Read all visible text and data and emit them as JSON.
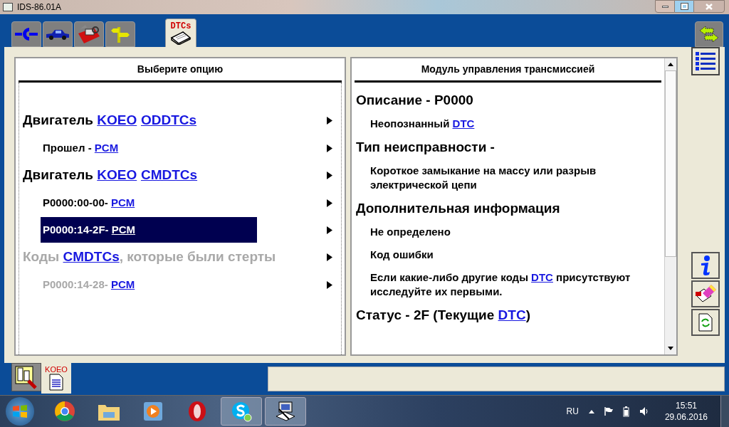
{
  "window": {
    "title": "IDS-86.01A"
  },
  "top_tabs": [
    {
      "kind": "connect",
      "selected": false
    },
    {
      "kind": "car",
      "selected": false
    },
    {
      "kind": "toolbox",
      "selected": false
    },
    {
      "kind": "signpost",
      "selected": false
    },
    {
      "kind": "dtc",
      "label": "DTCs",
      "selected": true
    }
  ],
  "left_panel": {
    "title": "Выберите опцию",
    "items": [
      {
        "kind": "heading",
        "selected": false,
        "disabled": false,
        "parts": [
          {
            "text": "Двигатель "
          },
          {
            "text": "KOEO",
            "link": true
          },
          {
            "text": "ODDTCs",
            "link": true
          }
        ]
      },
      {
        "kind": "sub",
        "selected": false,
        "disabled": false,
        "parts": [
          {
            "text": "Прошел - "
          },
          {
            "text": "PCM",
            "link": true
          }
        ]
      },
      {
        "kind": "heading",
        "selected": false,
        "disabled": false,
        "parts": [
          {
            "text": "Двигатель "
          },
          {
            "text": "KOEO",
            "link": true
          },
          {
            "text": "CMDTCs",
            "link": true
          }
        ]
      },
      {
        "kind": "sub",
        "selected": false,
        "disabled": false,
        "parts": [
          {
            "text": "P0000:00-00- "
          },
          {
            "text": "PCM",
            "link": true
          }
        ]
      },
      {
        "kind": "sub",
        "selected": true,
        "disabled": false,
        "parts": [
          {
            "text": "P0000:14-2F- "
          },
          {
            "text": "PCM",
            "link": true
          }
        ]
      },
      {
        "kind": "heading",
        "selected": false,
        "disabled": true,
        "parts": [
          {
            "text": "Коды "
          },
          {
            "text": "CMDTCs",
            "link": true
          },
          {
            "text": ", которые были стерты"
          }
        ]
      },
      {
        "kind": "sub",
        "selected": false,
        "disabled": true,
        "parts": [
          {
            "text": "P0000:14-28- "
          },
          {
            "text": "PCM",
            "link": true
          }
        ]
      }
    ]
  },
  "right_panel": {
    "title": "Модуль управления трансмиссией",
    "sections": [
      {
        "heading": [
          {
            "text": "Описание - P0000"
          }
        ],
        "paragraphs": [
          [
            {
              "text": "Неопознанный "
            },
            {
              "text": "DTC",
              "link": true
            }
          ]
        ]
      },
      {
        "heading": [
          {
            "text": "Тип неисправности -"
          }
        ],
        "paragraphs": [
          [
            {
              "text": "Короткое замыкание на массу или разрыв электрической цепи"
            }
          ]
        ]
      },
      {
        "heading": [
          {
            "text": "Дополнительная информация"
          }
        ],
        "paragraphs": [
          [
            {
              "text": "Не определено"
            }
          ],
          [
            {
              "text": "Код ошибки"
            }
          ],
          [
            {
              "text": "Если какие-либо другие коды "
            },
            {
              "text": "DTC",
              "link": true
            },
            {
              "text": " присутствуют исследуйте их первыми."
            }
          ]
        ]
      },
      {
        "heading": [
          {
            "text": "Статус - 2F (Текущие "
          },
          {
            "text": "DTC",
            "link": true
          },
          {
            "text": ")"
          }
        ]
      }
    ]
  },
  "side_buttons": [
    {
      "kind": "info"
    },
    {
      "kind": "erase"
    },
    {
      "kind": "refresh"
    }
  ],
  "bottom_tabs": [
    {
      "kind": "report",
      "selected": false
    },
    {
      "kind": "doc",
      "label": "KOEO",
      "selected": true
    }
  ],
  "taskbar": {
    "apps": [
      {
        "kind": "chrome",
        "active": false
      },
      {
        "kind": "explorer",
        "active": false
      },
      {
        "kind": "media",
        "active": false
      },
      {
        "kind": "opera",
        "active": false
      },
      {
        "kind": "skype",
        "active": true
      },
      {
        "kind": "ids",
        "active": true
      }
    ],
    "language": "RU",
    "time": "15:51",
    "date": "29.06.2016"
  }
}
